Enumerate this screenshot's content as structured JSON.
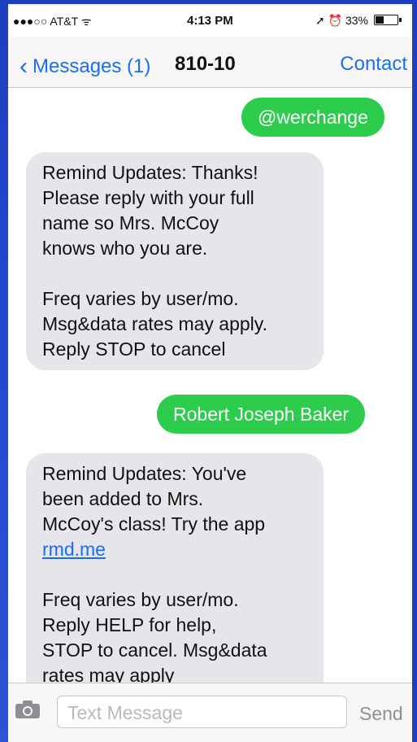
{
  "status_bar": {
    "carrier": "●●●○○ AT&T ᯤ",
    "time": "4:13 PM",
    "right": "➚ ⏰ 33%"
  },
  "nav": {
    "back_label": "Messages (1)",
    "title": "810-10",
    "contact_label": "Contact"
  },
  "messages": [
    {
      "direction": "outgoing",
      "text": "@werchange"
    },
    {
      "direction": "incoming",
      "text": "Remind Updates: Thanks!\nPlease reply with your full\nname so Mrs. McCoy\nknows who you are.\n\nFreq varies by user/mo.\nMsg&data rates may apply.\nReply STOP to cancel"
    },
    {
      "direction": "outgoing",
      "text": "Robert Joseph Baker"
    },
    {
      "direction": "incoming",
      "text_before_link": "Remind Updates: You've\nbeen added to Mrs.\nMcCoy's class! Try the app\n",
      "link": "rmd.me",
      "text_after_link": "\n\nFreq varies by user/mo.\nReply HELP for help,\nSTOP to cancel. Msg&data\nrates may apply"
    }
  ],
  "input": {
    "placeholder": "Text Message",
    "send_label": "Send"
  },
  "colors": {
    "outgoing_bubble": "#2ecc4d",
    "incoming_bubble": "#e5e5ea",
    "accent": "#1a6ef5",
    "frame": "#1f43c4"
  }
}
